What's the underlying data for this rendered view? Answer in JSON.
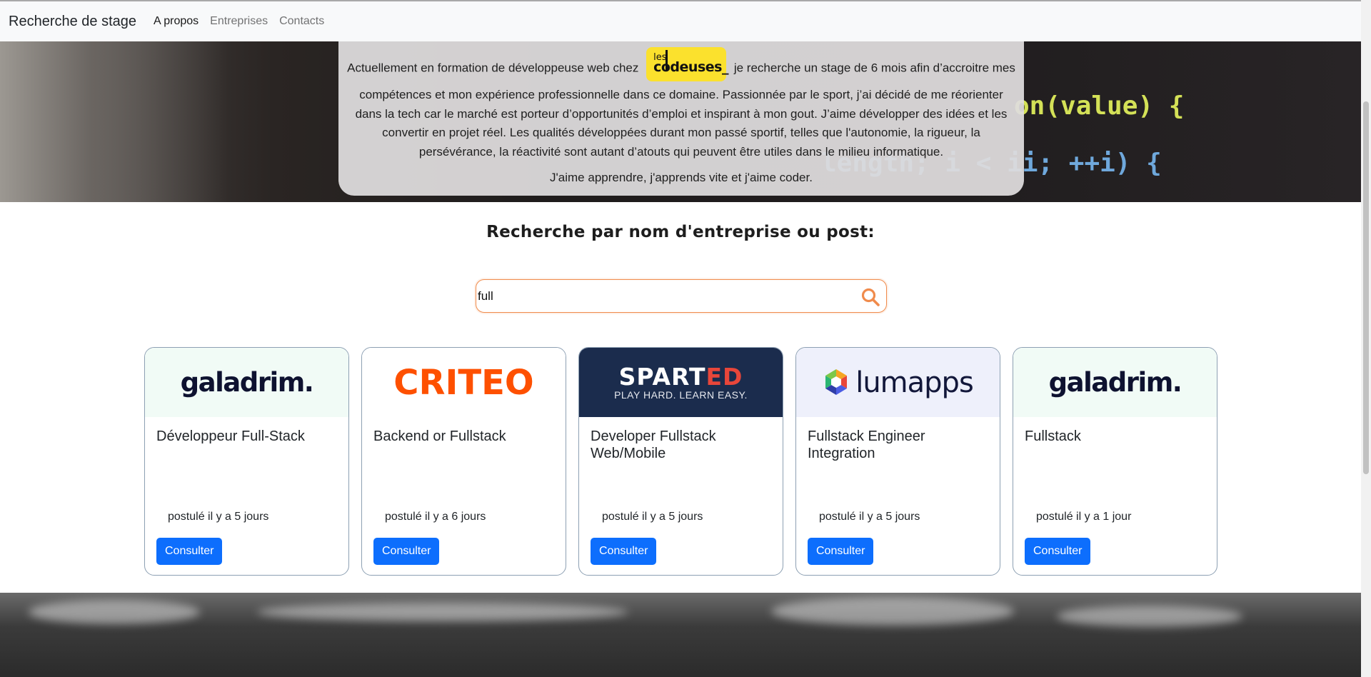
{
  "navbar": {
    "brand": "Recherche de stage",
    "links": [
      "A propos",
      "Entreprises",
      "Contacts"
    ]
  },
  "about": {
    "text_before_logo": "Actuellement en formation de développeuse web chez",
    "logo": {
      "line1": "les",
      "line2": "codeuses_"
    },
    "text_after_logo": "je recherche un stage de 6 mois afin d’accroitre mes compétences et mon expérience professionnelle dans ce domaine. Passionnée par le sport, j’ai décidé de me réorienter dans la tech car le marché est porteur d’opportunités d’emploi et inspirant à mon gout. J’aime développer des idées et les convertir en projet réel. Les qualités développées durant mon passé sportif, telles que l'autonomie, la rigueur, la persévérance, la réactivité sont autant d’atouts qui peuvent être utiles dans le milieu informatique.",
    "closing": "J'aime apprendre, j'apprends vite et j'aime coder."
  },
  "hero_code": {
    "line1": "on(value) {",
    "line2": "length; i < ii; ++i) {"
  },
  "search": {
    "title": "Recherche par nom d'entreprise ou post:",
    "value": "full",
    "icon": "search-icon"
  },
  "colors": {
    "accent": "#f08b4c",
    "button": "#0d6efd",
    "criteo": "#fe5000",
    "sparted_bg": "#1b2c4d",
    "lumapps_bg": "#eef0fb",
    "galadrim_bg": "#f1fbf6"
  },
  "cards": [
    {
      "company": "galadrim.",
      "title": "Développeur Full-Stack",
      "meta": "postulé il y a 5 jours",
      "button": "Consulter"
    },
    {
      "company": "CRITEO",
      "title": "Backend or Fullstack",
      "meta": "postulé il y a 6 jours",
      "button": "Consulter"
    },
    {
      "company": "SPARTED",
      "company_tag": "PLAY HARD. LEARN EASY.",
      "title": "Developer Fullstack Web/Mobile",
      "meta": "postulé il y a 5 jours",
      "button": "Consulter"
    },
    {
      "company": "lumapps",
      "title": "Fullstack Engineer Integration",
      "meta": "postulé il y a 5 jours",
      "button": "Consulter"
    },
    {
      "company": "galadrim.",
      "title": "Fullstack",
      "meta": "postulé il y a 1 jour",
      "button": "Consulter"
    }
  ]
}
